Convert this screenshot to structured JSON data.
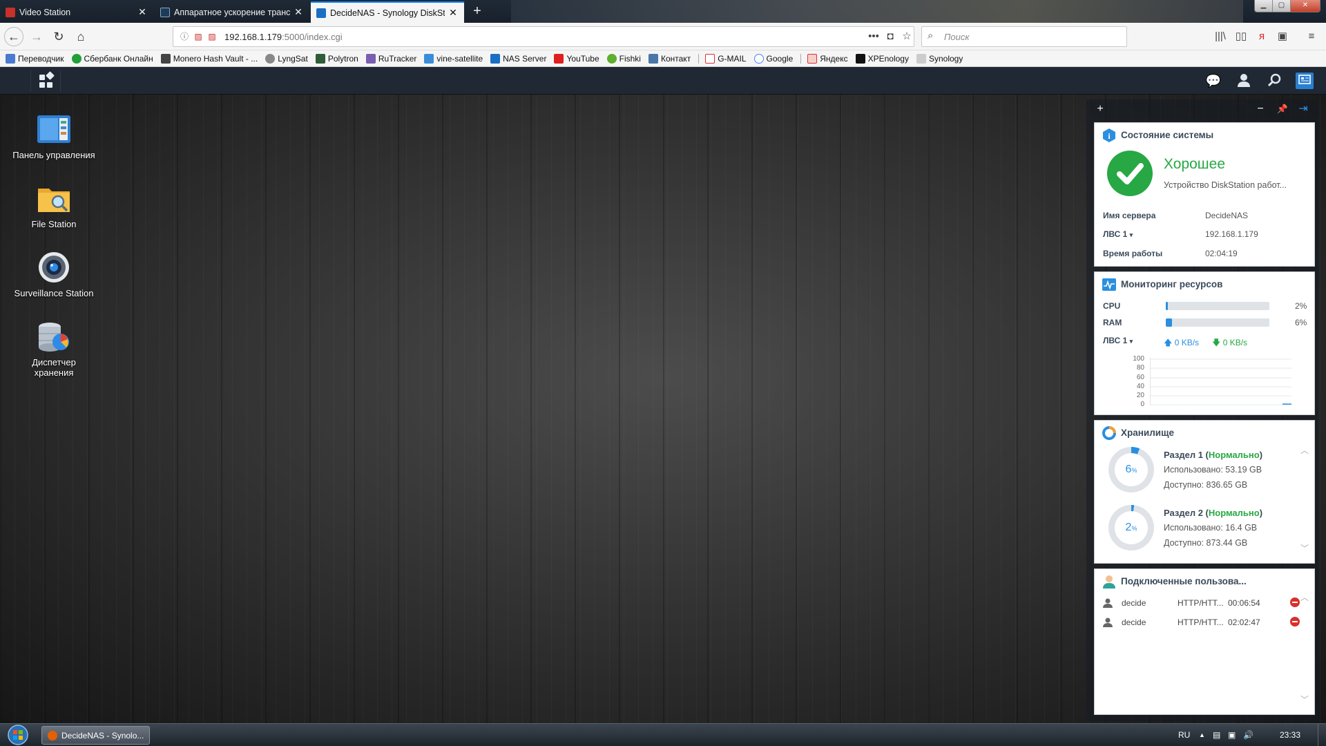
{
  "browser": {
    "tabs": [
      {
        "title": "Video Station",
        "active": false
      },
      {
        "title": "Аппаратное ускорение транс",
        "active": false
      },
      {
        "title": "DecideNAS - Synology DiskSta",
        "active": true
      }
    ],
    "url": {
      "host": "192.168.1.179",
      "rest": ":5000/index.cgi"
    },
    "search_placeholder": "Поиск",
    "bookmarks": [
      "Переводчик",
      "Сбербанк Онлайн",
      "Monero Hash Vault - ...",
      "LyngSat",
      "Polytron",
      "RuTracker",
      "vine-satellite",
      "NAS Server",
      "YouTube",
      "Fishki",
      "Контакт",
      "G-MAIL",
      "Google",
      "Яндекс",
      "XPEnology",
      "Synology"
    ]
  },
  "desktop": {
    "icons": [
      {
        "label": "Панель управления"
      },
      {
        "label": "File Station"
      },
      {
        "label": "Surveillance Station"
      },
      {
        "label": "Диспетчер хранения"
      }
    ]
  },
  "widgets": {
    "system": {
      "title": "Состояние системы",
      "status": "Хорошее",
      "status_desc": "Устройство DiskStation работ...",
      "server_name_label": "Имя сервера",
      "server_name": "DecideNAS",
      "lan_label": "ЛВС 1",
      "lan_ip": "192.168.1.179",
      "uptime_label": "Время работы",
      "uptime": "02:04:19"
    },
    "resource": {
      "title": "Мониторинг ресурсов",
      "cpu_label": "CPU",
      "cpu_pct": 2,
      "cpu_text": "2%",
      "ram_label": "RAM",
      "ram_pct": 6,
      "ram_text": "6%",
      "lan_label": "ЛВС 1",
      "up": "0 KB/s",
      "down": "0 KB/s",
      "y_ticks": [
        "100",
        "80",
        "60",
        "40",
        "20",
        "0"
      ]
    },
    "storage": {
      "title": "Хранилище",
      "volumes": [
        {
          "name": "Раздел 1",
          "status": "Нормально",
          "used": "Использовано: 53.19 GB",
          "avail": "Доступно: 836.65 GB",
          "pct": 6
        },
        {
          "name": "Раздел 2",
          "status": "Нормально",
          "used": "Использовано: 16.4 GB",
          "avail": "Доступно: 873.44 GB",
          "pct": 2
        }
      ]
    },
    "users": {
      "title": "Подключенные пользова...",
      "rows": [
        {
          "user": "decide",
          "proto": "HTTP/HTT...",
          "time": "00:06:54"
        },
        {
          "user": "decide",
          "proto": "HTTP/HTT...",
          "time": "02:02:47"
        }
      ]
    }
  },
  "taskbar": {
    "task": "DecideNAS - Synolo...",
    "lang": "RU",
    "time": "23:33"
  },
  "colors": {
    "accent": "#2a8fe0",
    "ok": "#27a844",
    "danger": "#d9302b"
  }
}
